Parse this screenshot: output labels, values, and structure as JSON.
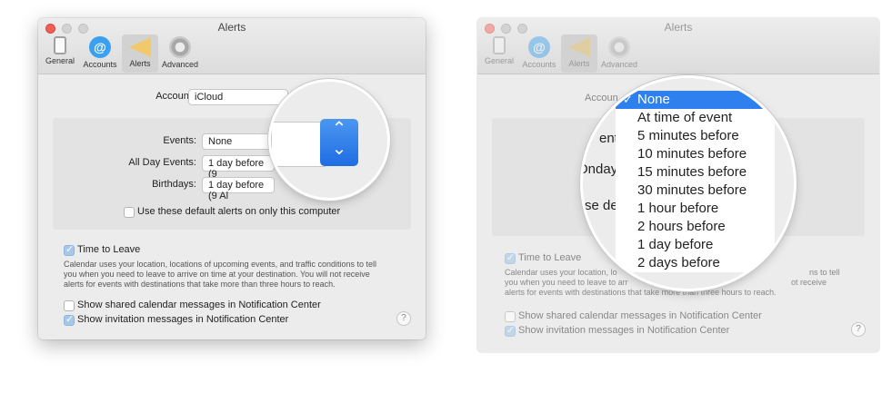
{
  "left_window": {
    "title": "Alerts",
    "tabs": [
      {
        "label": "General"
      },
      {
        "label": "Accounts"
      },
      {
        "label": "Alerts"
      },
      {
        "label": "Advanced"
      }
    ],
    "account_label": "Account:",
    "account_value": "iCloud",
    "events_label": "Events:",
    "events_value": "None",
    "allday_label": "All Day Events:",
    "allday_value": "1 day before (9",
    "birthdays_label": "Birthdays:",
    "birthdays_value": "1 day before (9 Al",
    "default_alerts_label": "Use these default alerts on only this computer",
    "time_to_leave_label": "Time to Leave",
    "time_to_leave_desc_1": "Calendar uses your location, locations of upcoming events, and traffic conditions to tell",
    "time_to_leave_desc_2": "you when you need to leave to arrive on time at your destination. You will not receive",
    "time_to_leave_desc_3": "alerts for events with destinations that take more than three hours to reach.",
    "shared_label": "Show shared calendar messages in Notification Center",
    "invitation_label": "Show invitation messages in Notification Center",
    "help": "?"
  },
  "right_window": {
    "title": "Alerts",
    "tabs": [
      {
        "label": "General"
      },
      {
        "label": "Accounts"
      },
      {
        "label": "Alerts"
      },
      {
        "label": "Advanced"
      }
    ],
    "account_label": "Accoun",
    "events_label": "ents",
    "allday_label": "Ondays",
    "default_partial": "se def",
    "time_to_leave_label": "Time to Leave",
    "time_to_leave_desc_1": "Calendar uses your location, lo",
    "time_to_leave_desc_1b": "ns to tell",
    "time_to_leave_desc_2": "you when you need to leave to arr",
    "time_to_leave_desc_2b": "ot receive",
    "time_to_leave_desc_3": "alerts for events with destinations that take more than three hours to reach.",
    "shared_label": "Show shared calendar messages in Notification Center",
    "invitation_label": "Show invitation messages in Notification Center",
    "help": "?"
  },
  "menu": {
    "check": "✓",
    "options": [
      "None",
      "At time of event",
      "5 minutes before",
      "10 minutes before",
      "15 minutes before",
      "30 minutes before",
      "1 hour before",
      "2 hours before",
      "1 day before",
      "2 days before"
    ],
    "selected": "None"
  },
  "stepper": {
    "up": "⌃",
    "down": "⌄"
  }
}
